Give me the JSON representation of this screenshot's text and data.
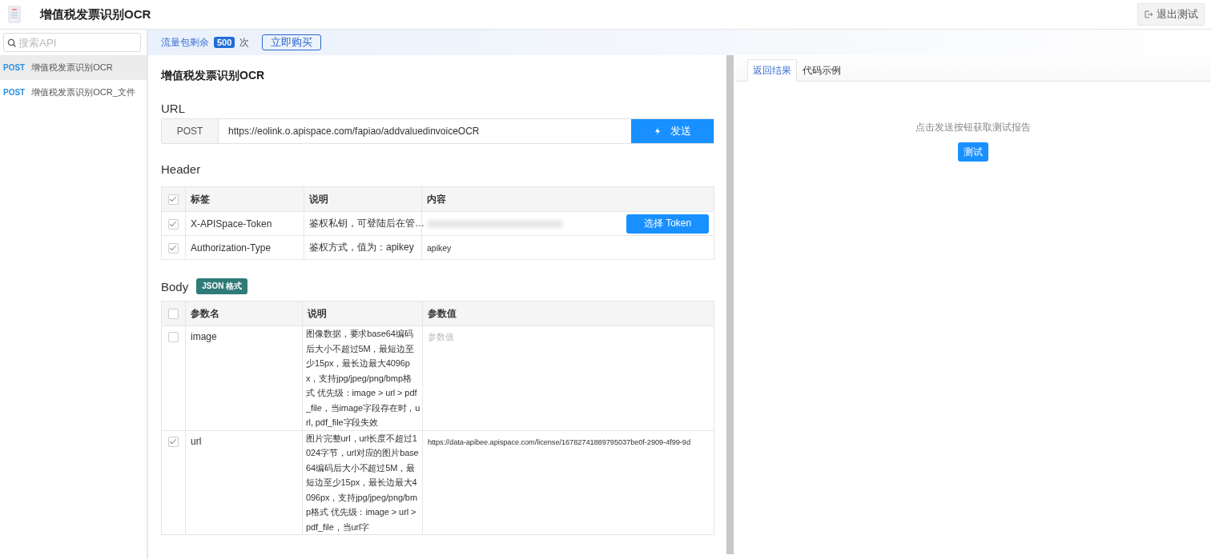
{
  "header": {
    "title": "增值税发票识别OCR",
    "exit_button": "退出测试"
  },
  "sidebar": {
    "search_placeholder": "搜索API",
    "items": [
      {
        "method": "POST",
        "name": "增值税发票识别OCR",
        "selected": true
      },
      {
        "method": "POST",
        "name": "增值税发票识别OCR_文件",
        "selected": false
      }
    ]
  },
  "quota": {
    "label": "流量包剩余",
    "count": "500",
    "unit": "次",
    "buy_button": "立即购买"
  },
  "main": {
    "title": "增值税发票识别OCR",
    "url_section": {
      "heading": "URL",
      "method": "POST",
      "url": "https://eolink.o.apispace.com/fapiao/addvaluedinvoiceOCR",
      "send_button": "发送"
    },
    "header_section": {
      "heading": "Header",
      "all_checked": true,
      "columns": [
        "标签",
        "说明",
        "内容"
      ],
      "rows": [
        {
          "kind": "token",
          "checked": true,
          "name": "X-APISpace-Token",
          "description": "鉴权私钥，可登陆后在管…",
          "token_button": "选择 Token"
        },
        {
          "kind": "text",
          "checked": true,
          "name": "Authorization-Type",
          "description": "鉴权方式，值为：apikey",
          "value": "apikey"
        }
      ]
    },
    "body_section": {
      "heading": "Body",
      "format_badge": "JSON 格式",
      "all_checked": false,
      "columns": [
        "参数名",
        "说明",
        "参数值"
      ],
      "rows": [
        {
          "checked": false,
          "name": "image",
          "description": "图像数据，要求base64编码后大小不超过5M，最短边至少15px，最长边最大4096px，支持jpg/jpeg/png/bmp格式 优先级：image > url > pdf_file，当image字段存在时，url, pdf_file字段失效",
          "placeholder": "参数值"
        },
        {
          "checked": true,
          "name": "url",
          "description": "图片完整url，url长度不超过1024字节，url对应的图片base64编码后大小不超过5M，最短边至少15px，最长边最大4096px，支持jpg/jpeg/png/bmp格式 优先级：image > url > pdf_file，当url字",
          "value": "https://data-apibee.apispace.com/license/16782741889795037be0f-2909-4f99-9d"
        }
      ]
    }
  },
  "result_panel": {
    "tabs": [
      {
        "label": "返回结果",
        "selected": true
      },
      {
        "label": "代码示例",
        "selected": false
      }
    ],
    "hint": "点击发送按钮获取测试报告",
    "test_button": "测试"
  }
}
